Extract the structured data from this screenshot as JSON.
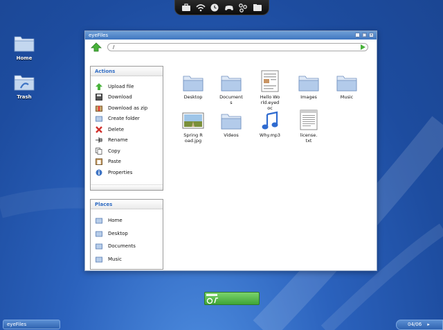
{
  "desktop": {
    "icons": [
      {
        "label": "Home"
      },
      {
        "label": "Trash"
      }
    ]
  },
  "dock": {
    "icons": [
      "briefcase-icon",
      "wifi-icon",
      "clock-icon",
      "gamepad-icon",
      "network-icon",
      "folder-icon"
    ]
  },
  "window": {
    "title": "eyeFiles",
    "path": "/",
    "controls": [
      "_",
      "□",
      "×"
    ]
  },
  "actions": {
    "title": "Actions",
    "items": [
      {
        "label": "Upload file",
        "icon": "upload-icon"
      },
      {
        "label": "Download",
        "icon": "download-icon"
      },
      {
        "label": "Download as zip",
        "icon": "zip-icon"
      },
      {
        "label": "Create folder",
        "icon": "new-folder-icon"
      },
      {
        "label": "Delete",
        "icon": "delete-icon"
      },
      {
        "label": "Rename",
        "icon": "rename-icon"
      },
      {
        "label": "Copy",
        "icon": "copy-icon"
      },
      {
        "label": "Paste",
        "icon": "paste-icon"
      },
      {
        "label": "Properties",
        "icon": "info-icon"
      }
    ]
  },
  "places": {
    "title": "Places",
    "items": [
      {
        "label": "Home"
      },
      {
        "label": "Desktop"
      },
      {
        "label": "Documents"
      },
      {
        "label": "Music"
      }
    ]
  },
  "files": [
    {
      "name": "Desktop",
      "type": "folder"
    },
    {
      "name": "Document\ns",
      "type": "folder"
    },
    {
      "name": "Hello Wo\nrld.eyed\noc",
      "type": "doc"
    },
    {
      "name": "Images",
      "type": "folder"
    },
    {
      "name": "Music",
      "type": "folder"
    },
    {
      "name": "Spring R\noad.jpg",
      "type": "image"
    },
    {
      "name": "Videos",
      "type": "folder"
    },
    {
      "name": "Why.mp3",
      "type": "audio"
    },
    {
      "name": "license.\ntxt",
      "type": "text"
    }
  ],
  "taskbar": {
    "item": "eyeFiles",
    "date": "04/06"
  },
  "colors": {
    "accent": "#2f6bc3",
    "titlebar": "#4f86cc",
    "launcher": "#55bb46"
  }
}
